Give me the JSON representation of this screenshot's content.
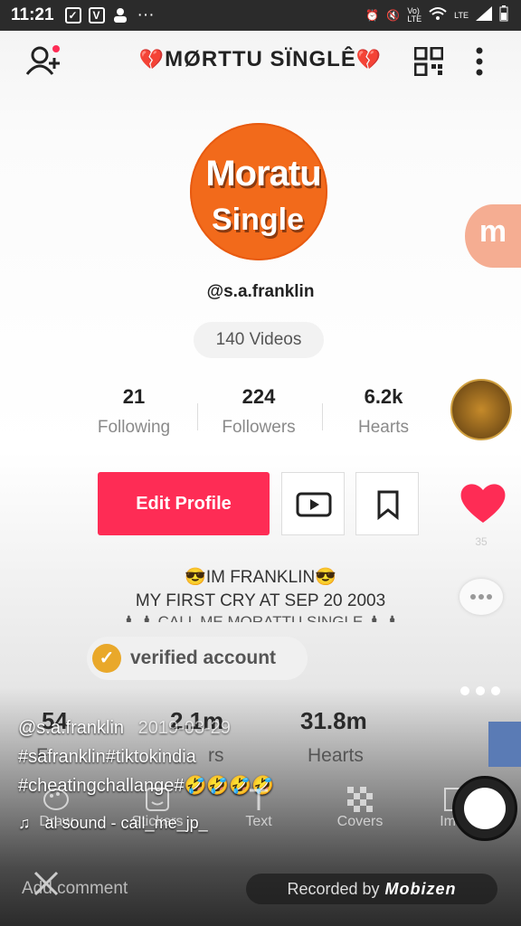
{
  "status_bar": {
    "time": "11:21",
    "left_icons": [
      "messenger-icon",
      "v-icon",
      "person-icon",
      "ellipsis-icon"
    ],
    "right_icons": [
      "alarm-icon",
      "mute-icon",
      "volte-icon",
      "wifi-icon",
      "lte-icon",
      "signal-icon",
      "battery-icon"
    ]
  },
  "header": {
    "title_prefix": "💔",
    "title": "MØRTTU SÏNGLÊ",
    "title_suffix": "💔"
  },
  "profile": {
    "avatar_line1": "Moratu",
    "avatar_line2": "Single",
    "username": "@s.a.franklin",
    "videos_label": "140 Videos"
  },
  "stats": [
    {
      "value": "21",
      "label": "Following"
    },
    {
      "value": "224",
      "label": "Followers"
    },
    {
      "value": "6.2k",
      "label": "Hearts"
    }
  ],
  "actions": {
    "edit_profile": "Edit Profile"
  },
  "bio": {
    "line1": "😎IM FRANKLIN😎",
    "line2": "MY FIRST CRY AT SEP 20 2003",
    "line3": "♟ ♟ CALL ME MORATTU SINGLE ♟ ♟"
  },
  "verified": {
    "label": "verified account"
  },
  "right_rail": {
    "logo_letter": "m",
    "like_count": "35"
  },
  "ghost_stats": [
    {
      "value": "54",
      "label": "F"
    },
    {
      "value": "2.1m",
      "label": "rs"
    },
    {
      "value": "31.8m",
      "label": "Hearts"
    }
  ],
  "video_overlay": {
    "author": "@s.a.franklin",
    "date": "2019-03-29",
    "caption_line1": "#safranklin#tiktokindia",
    "caption_line2": "#cheatingchallange#🤣🤣🤣🤣",
    "sound": "al sound - call_me_jp_"
  },
  "editor_tools": [
    {
      "label": "Draw",
      "icon": "palette-icon"
    },
    {
      "label": "Stickers",
      "icon": "sticker-icon"
    },
    {
      "label": "Text",
      "icon": "text-icon"
    },
    {
      "label": "Covers",
      "icon": "checker-icon"
    },
    {
      "label": "Imag",
      "icon": "image-icon"
    }
  ],
  "bottom": {
    "add_comment": "Add comment",
    "recorder_prefix": "Recorded by",
    "recorder_brand": "Mobizen"
  }
}
